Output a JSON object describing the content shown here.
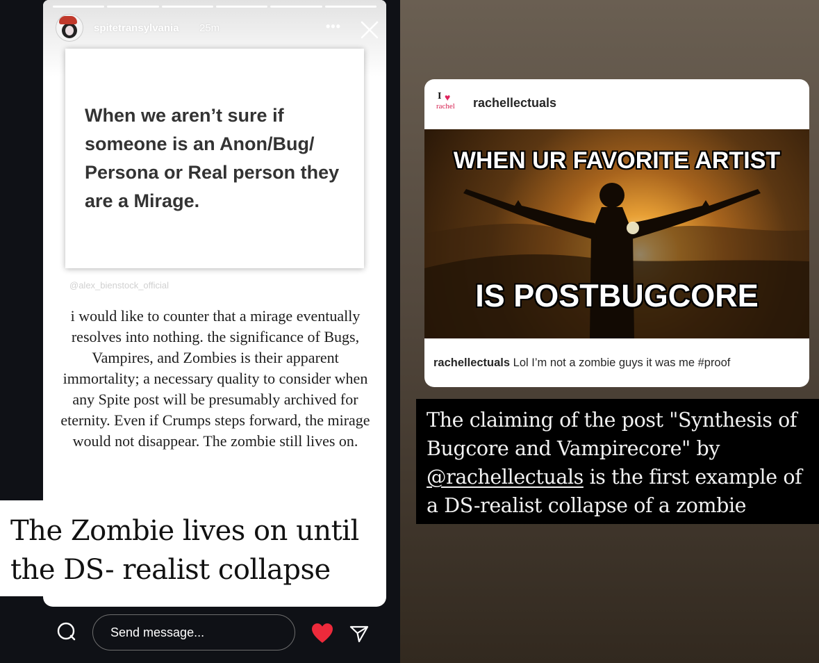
{
  "left_story": {
    "username": "spitetransylvania",
    "time": "25m",
    "more_icon": "•••",
    "quote_text": "When we aren’t sure if someone is an Anon/Bug/ Persona or Real person they are a Mirage.",
    "watermark": "@alex_bienstock_official",
    "body_text": "i would like to counter that a mirage eventually resolves into nothing. the significance of Bugs, Vampires, and Zombies is their apparent immortality; a necessary quality to consider when any Spite post will be presumably archived for eternity. Even if Crumps steps forward, the mirage would not disappear. The zombie still lives on.",
    "caption": "The Zombie lives on until the DS- realist collapse",
    "footer": {
      "message_placeholder": "Send message...",
      "icons": [
        "chat-bubble-icon",
        "heart-icon",
        "send-icon"
      ],
      "heart_color": "#ed2a3b"
    }
  },
  "right_story": {
    "brand_logo": {
      "line1": "I",
      "line2": "rachel"
    },
    "post_username": "rachellectuals",
    "meme_top": "WHEN UR FAVORITE ARTIST",
    "meme_bottom": "IS POSTBUGCORE",
    "caption_user": "rachellectuals",
    "caption_text": " Lol I’m not a zombie guys it was me #proof",
    "overlay_before": "The claiming of the post \"Synthesis of Bugcore and Vampirecore\" by ",
    "overlay_mention": "@rachellectuals",
    "overlay_after": " is the first example of a DS-realist collapse of a zombie"
  }
}
